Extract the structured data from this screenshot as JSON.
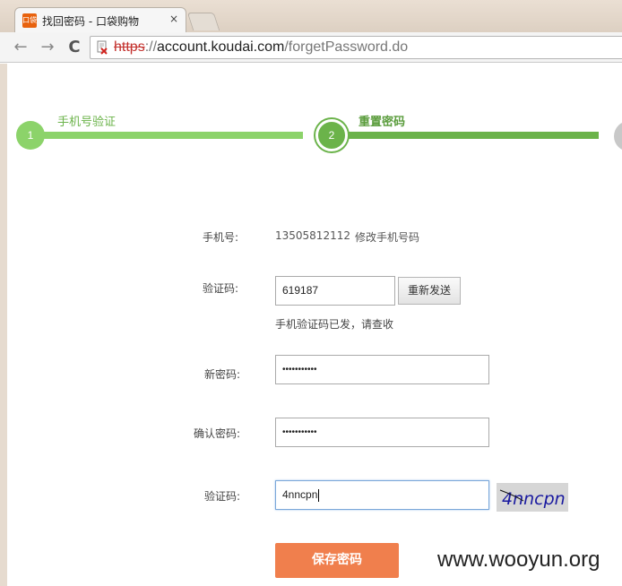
{
  "browser": {
    "tab_title": "找回密码 - 口袋购物",
    "favicon_text": "口袋",
    "close_glyph": "×",
    "url_protocol": "https",
    "url_separator": "://",
    "url_host": "account.koudai.com",
    "url_path": "/forgetPassword.do",
    "nav_back": "←",
    "nav_forward": "→",
    "nav_reload": "C"
  },
  "steps": [
    {
      "number": "1",
      "label": "手机号验证"
    },
    {
      "number": "2",
      "label": "重置密码"
    }
  ],
  "form": {
    "phone_label": "手机号:",
    "phone_value": "13505812112",
    "change_phone_link": "修改手机号码",
    "sms_code_label": "验证码:",
    "sms_code_value": "619187",
    "resend_button": "重新发送",
    "sms_hint": "手机验证码已发，请查收",
    "new_password_label": "新密码:",
    "new_password_value": "•••••••••••",
    "confirm_password_label": "确认密码:",
    "confirm_password_value": "•••••••••••",
    "captcha_label": "验证码:",
    "captcha_value": "4nncpn",
    "captcha_image_text": "4nncpn",
    "save_button": "保存密码"
  },
  "watermark": "www.wooyun.org",
  "colors": {
    "step_done": "#8cd36a",
    "step_active": "#6bb34a",
    "step_pending": "#c8c8c8",
    "save_button": "#f07f4d"
  }
}
